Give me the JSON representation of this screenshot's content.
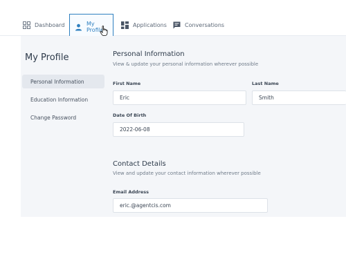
{
  "nav": {
    "tabs": [
      {
        "label": "Dashboard",
        "icon": "dashboard-grid-icon"
      },
      {
        "label": "My Profile",
        "icon": "user-icon"
      },
      {
        "label": "Applications",
        "icon": "applications-icon"
      },
      {
        "label": "Conversations",
        "icon": "chat-icon"
      }
    ],
    "active_tab": "My Profile"
  },
  "sidebar": {
    "title": "My Profile",
    "items": [
      {
        "label": "Personal Information"
      },
      {
        "label": "Education Information"
      },
      {
        "label": "Change Password"
      }
    ],
    "active_item": "Personal Information"
  },
  "personal": {
    "title": "Personal Information",
    "subtitle": "View & update your personal information wherever possible",
    "first_name_label": "First Name",
    "first_name": "Eric",
    "last_name_label": "Last Name",
    "last_name": "Smith",
    "dob_label": "Date Of Birth",
    "dob": "2022-06-08"
  },
  "contact": {
    "title": "Contact Details",
    "subtitle": "View and update your contact information wherever possible",
    "email_label": "Email Address",
    "email": "eric.@agentcis.com"
  },
  "colors": {
    "accent": "#2e7fbf",
    "page_bg": "#f4f6f9",
    "active_item_bg": "#e4e8ee"
  }
}
